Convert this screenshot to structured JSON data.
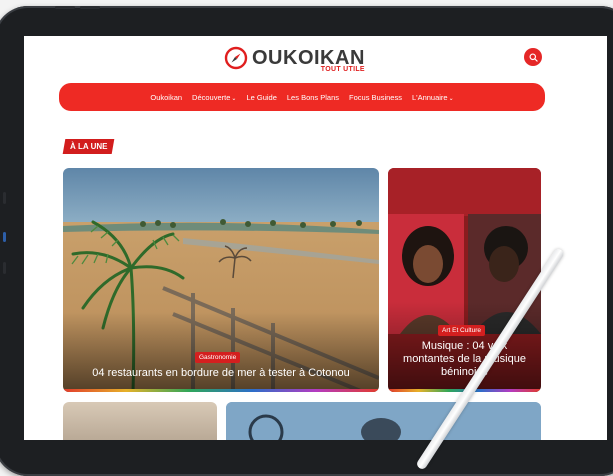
{
  "site": {
    "title": "OUKOIKAN",
    "tagline": "TOUT UTILE"
  },
  "nav": {
    "items": [
      {
        "label": "Oukoikan",
        "dropdown": false
      },
      {
        "label": "Découverte",
        "dropdown": true
      },
      {
        "label": "Le Guide",
        "dropdown": false
      },
      {
        "label": "Les Bons Plans",
        "dropdown": false
      },
      {
        "label": "Focus Business",
        "dropdown": false
      },
      {
        "label": "L'Annuaire",
        "dropdown": true
      }
    ]
  },
  "section": {
    "title": "À LA UNE"
  },
  "articles": [
    {
      "category": "Gastronomie",
      "title": "04 restaurants en bordure de mer à tester à Cotonou"
    },
    {
      "category": "Art Et Culture",
      "title": "Musique : 04 voix montantes de la musique béninoise"
    }
  ],
  "colors": {
    "brand": "#ee2a24",
    "badge": "#d41f1f",
    "frame": "#1d1f22"
  },
  "icons": {
    "search": "search-icon",
    "logo": "compass-icon"
  }
}
